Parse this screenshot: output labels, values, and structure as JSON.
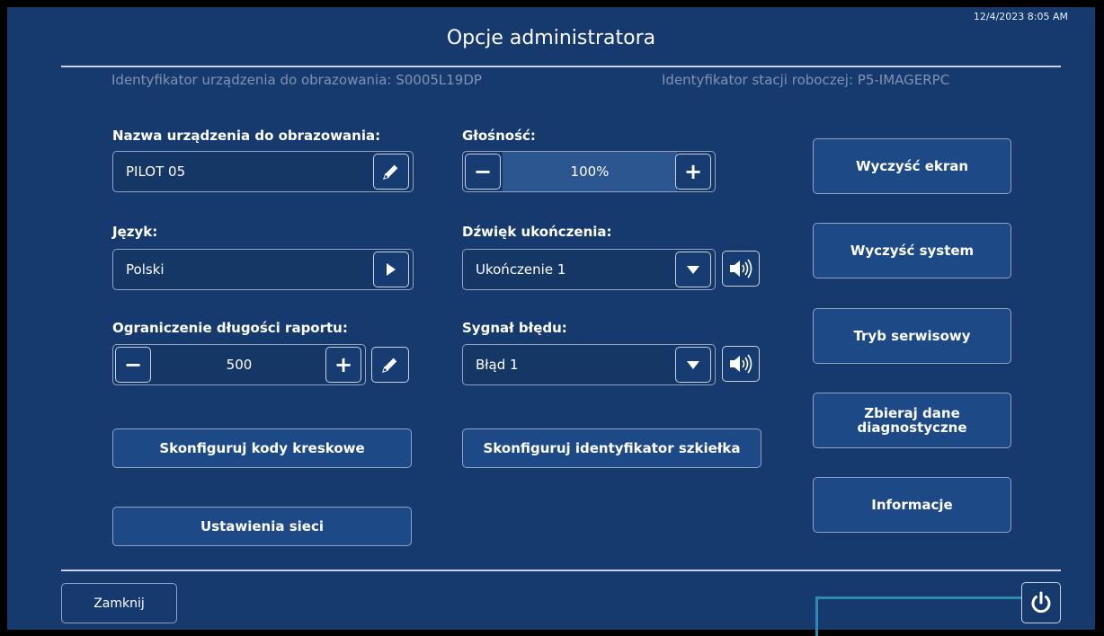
{
  "datetime": "12/4/2023 8:05 AM",
  "title": "Opcje administratora",
  "ids": {
    "device": "Identyfikator urządzenia do obrazowania: S0005L19DP",
    "workstation": "Identyfikator stacji roboczej: P5-IMAGERPC"
  },
  "device_name": {
    "label": "Nazwa urządzenia do obrazowania:",
    "value": "PILOT 05",
    "edit_icon": "pencil-icon"
  },
  "language": {
    "label": "Język:",
    "value": "Polski",
    "icon": "triangle-right-icon"
  },
  "report_limit": {
    "label": "Ograniczenie długości raportu:",
    "value": "500",
    "minus": "−",
    "plus": "+",
    "edit_icon": "pencil-icon"
  },
  "volume": {
    "label": "Głośność:",
    "value": "100%",
    "level": 1.0,
    "minus": "−",
    "plus": "+"
  },
  "completion_sound": {
    "label": "Dźwięk ukończenia:",
    "value": "Ukończenie 1",
    "icons": [
      "chevron-down-icon",
      "speaker-icon"
    ]
  },
  "error_signal": {
    "label": "Sygnał błędu:",
    "value": "Błąd 1",
    "icons": [
      "chevron-down-icon",
      "speaker-icon"
    ]
  },
  "buttons": {
    "barcodes": "Skonfiguruj kody kreskowe",
    "network": "Ustawienia sieci",
    "slide_id": "Skonfiguruj identyfikator szkiełka",
    "clear_screen": "Wyczyść ekran",
    "clear_system": "Wyczyść system",
    "service_mode": "Tryb serwisowy",
    "collect_diag_1": "Zbieraj dane",
    "collect_diag_2": "diagnostyczne",
    "info": "Informacje",
    "close": "Zamknij"
  },
  "colors": {
    "background": "#163a6e",
    "button": "#1d4a86",
    "accent": "#2a8ab0",
    "id_text": "#7f93b3"
  }
}
